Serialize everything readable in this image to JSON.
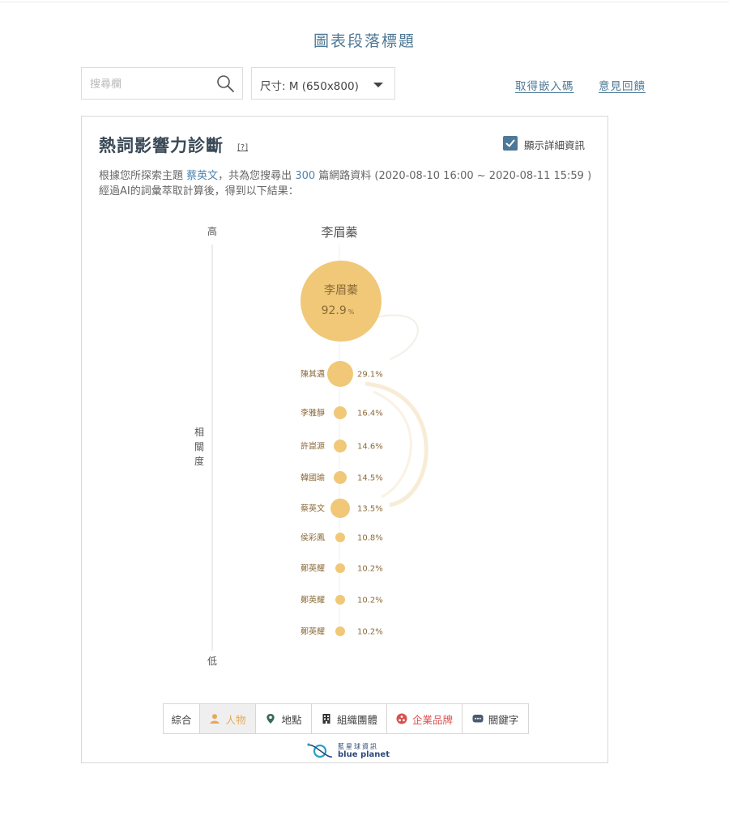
{
  "page": {
    "title": "圖表段落標題"
  },
  "toolbar": {
    "search_placeholder": "搜尋欄",
    "size_select_label": "尺寸: M (650x800)",
    "embed_link": "取得嵌入碼",
    "feedback_link": "意見回饋"
  },
  "card": {
    "title": "熱詞影響力診斷",
    "help": "[?]",
    "detail_label": "顯示詳細資訊",
    "detail_checked": true,
    "desc_prefix": "根據您所探索主題",
    "desc_topic": "蔡英文",
    "desc_mid": "，共為您搜尋出",
    "desc_count": "300",
    "desc_suffix": "篇網路資料 (2020-08-10 16:00 ~ 2020-08-11 15:59 )",
    "desc_line2": "經過AI的詞彙萃取計算後，得到以下結果："
  },
  "chart_data": {
    "type": "bubble-ranking",
    "header": "李眉蓁",
    "axis_high": "高",
    "axis_low": "低",
    "axis_label": [
      "相",
      "關",
      "度"
    ],
    "main": {
      "name": "李眉蓁",
      "value": "92.9",
      "unit": "%"
    },
    "items": [
      {
        "name": "陳其邁",
        "value": "29.1%",
        "size": "large"
      },
      {
        "name": "李雅靜",
        "value": "16.4%",
        "size": "small"
      },
      {
        "name": "許崑源",
        "value": "14.6%",
        "size": "small"
      },
      {
        "name": "韓國瑜",
        "value": "14.5%",
        "size": "small"
      },
      {
        "name": "蔡英文",
        "value": "13.5%",
        "size": "medium"
      },
      {
        "name": "侯彩鳳",
        "value": "10.8%",
        "size": "tiny"
      },
      {
        "name": "鄭英耀",
        "value": "10.2%",
        "size": "tiny"
      },
      {
        "name": "鄭英耀",
        "value": "10.2%",
        "size": "tiny"
      },
      {
        "name": "鄭英耀",
        "value": "10.2%",
        "size": "tiny"
      }
    ],
    "colors": {
      "bubble": "#f0c878",
      "text": "#8a6a3a",
      "axis": "#e6e6e6"
    }
  },
  "tabs": [
    {
      "label": "綜合",
      "icon": "none",
      "active": false
    },
    {
      "label": "人物",
      "icon": "person-icon",
      "active": true
    },
    {
      "label": "地點",
      "icon": "location-pin-icon",
      "active": false
    },
    {
      "label": "組織團體",
      "icon": "building-icon",
      "active": false
    },
    {
      "label": "企業品牌",
      "icon": "brand-icon",
      "active": false
    },
    {
      "label": "關鍵字",
      "icon": "chat-icon",
      "active": false
    }
  ],
  "logo": {
    "cn": "藍星球資訊",
    "en": "blue planet"
  }
}
